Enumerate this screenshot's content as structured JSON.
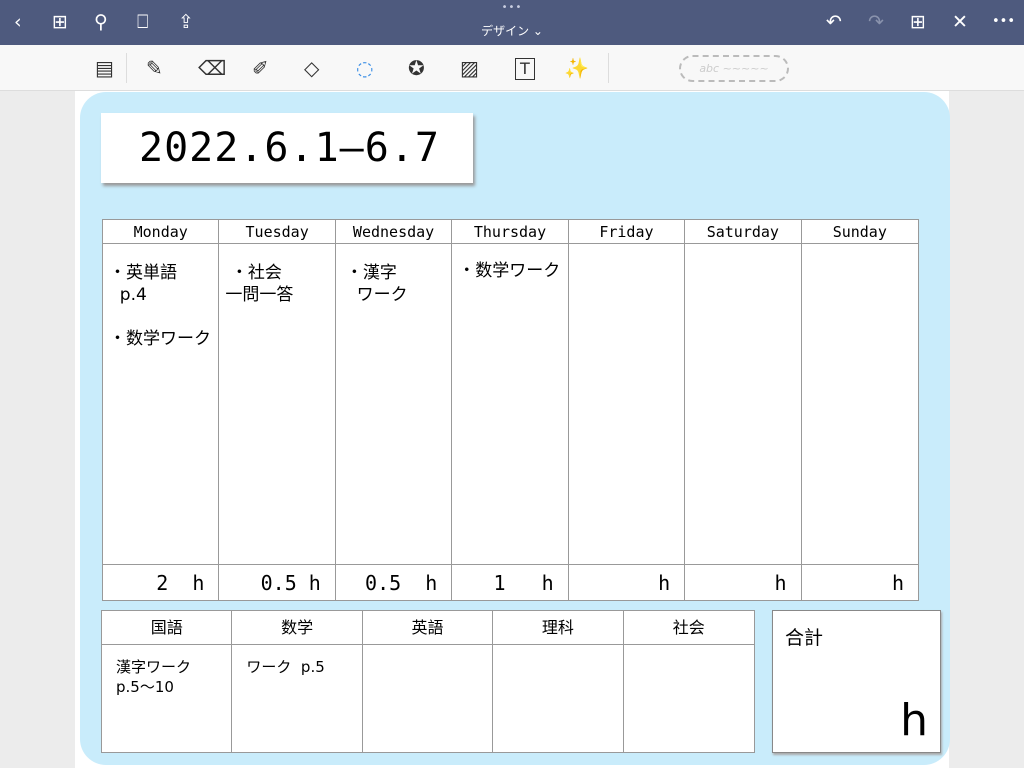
{
  "topbar": {
    "title": "デザイン ⌄",
    "dots": "•••",
    "icons": {
      "back": "‹",
      "grid": "⊞",
      "search": "⚲",
      "bookmark": "⎕",
      "share": "⇪",
      "undo": "↶",
      "redo": "↷",
      "add_page": "⊞",
      "close": "✕",
      "more": "•••"
    }
  },
  "toolbar": {
    "tools": [
      "▤",
      "✎",
      "⌫",
      "✐",
      "◇",
      "◌",
      "✪",
      "▨",
      "T",
      "✨"
    ],
    "abc": "abc ~~~~~"
  },
  "date": "2022.6.1—6.7",
  "week": {
    "days": [
      "Monday",
      "Tuesday",
      "Wednesday",
      "Thursday",
      "Friday",
      "Saturday",
      "Sunday"
    ],
    "tasks": [
      "・英単語\n  p.4\n\n・数学ワーク",
      " ・社会\n一問一答",
      "・漢字\n  ワーク",
      "・数学ワーク",
      "",
      "",
      ""
    ],
    "hours": [
      "2  h",
      "0.5 h",
      "0.5  h",
      "1   h",
      "h",
      "h",
      "h"
    ]
  },
  "subjects": {
    "headers": [
      "国語",
      "数学",
      "英語",
      "理科",
      "社会"
    ],
    "notes": [
      "漢字ワーク\np.5〜10",
      "ワーク  p.5",
      "",
      "",
      ""
    ]
  },
  "total": {
    "label": "合計",
    "unit": "h"
  }
}
